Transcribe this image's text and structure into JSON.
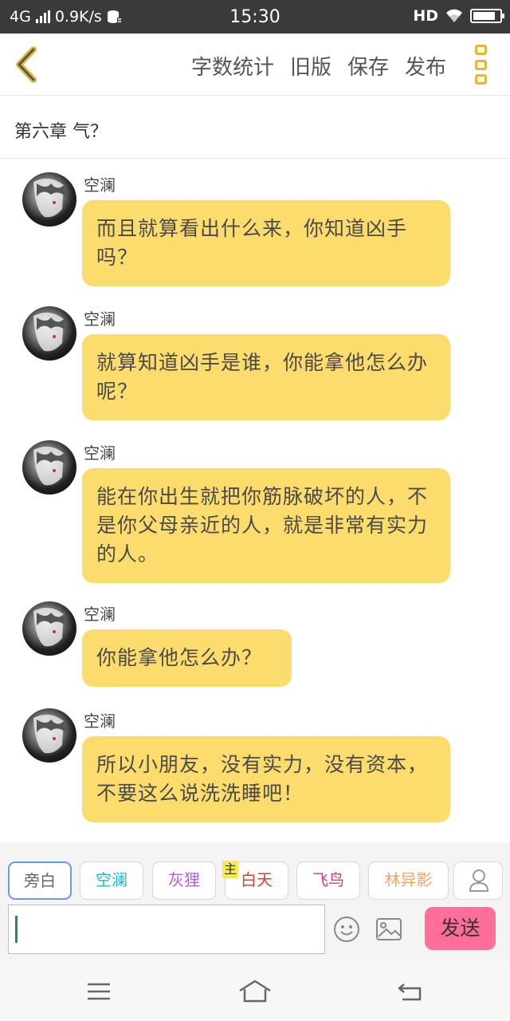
{
  "status_bar": {
    "network": "4G",
    "speed": "0.9K/s",
    "time": "15:30",
    "hd": "HD",
    "battery_percent": 85
  },
  "header": {
    "actions": [
      "字数统计",
      "旧版",
      "保存",
      "发布"
    ],
    "accent_color": "#e0b83b"
  },
  "chapter_title": "第六章 气？",
  "messages": [
    {
      "sender": "空澜",
      "text": "而且就算看出什么来，你知道凶手吗？"
    },
    {
      "sender": "空澜",
      "text": "就算知道凶手是谁，你能拿他怎么办呢？"
    },
    {
      "sender": "空澜",
      "text": "能在你出生就把你筋脉破坏的人，不是你父母亲近的人，就是非常有实力的人。"
    },
    {
      "sender": "空澜",
      "text": "你能拿他怎么办？"
    },
    {
      "sender": "空澜",
      "text": "所以小朋友，没有实力，没有资本，不要这么说洗洗睡吧！"
    }
  ],
  "bubble_color": "#fddc6e",
  "roles": [
    {
      "label": "旁白",
      "color": "#666666",
      "selected": true
    },
    {
      "label": "空澜",
      "color": "#26b3c9"
    },
    {
      "label": "灰狸",
      "color": "#b05fd6"
    },
    {
      "label": "白天",
      "color": "#e23b3b",
      "badge": "主"
    },
    {
      "label": "飞鸟",
      "color": "#e0357a"
    },
    {
      "label": "林异影",
      "color": "#f0a56a"
    }
  ],
  "input": {
    "value": "",
    "send_label": "发送",
    "send_color": "#ff6f9a"
  },
  "icons": {
    "back": "chevron-left-icon",
    "more": "more-vertical-icon",
    "emoji": "smiley-icon",
    "image": "image-icon",
    "user": "person-icon",
    "nav": [
      "menu-icon",
      "home-icon",
      "return-icon"
    ]
  }
}
